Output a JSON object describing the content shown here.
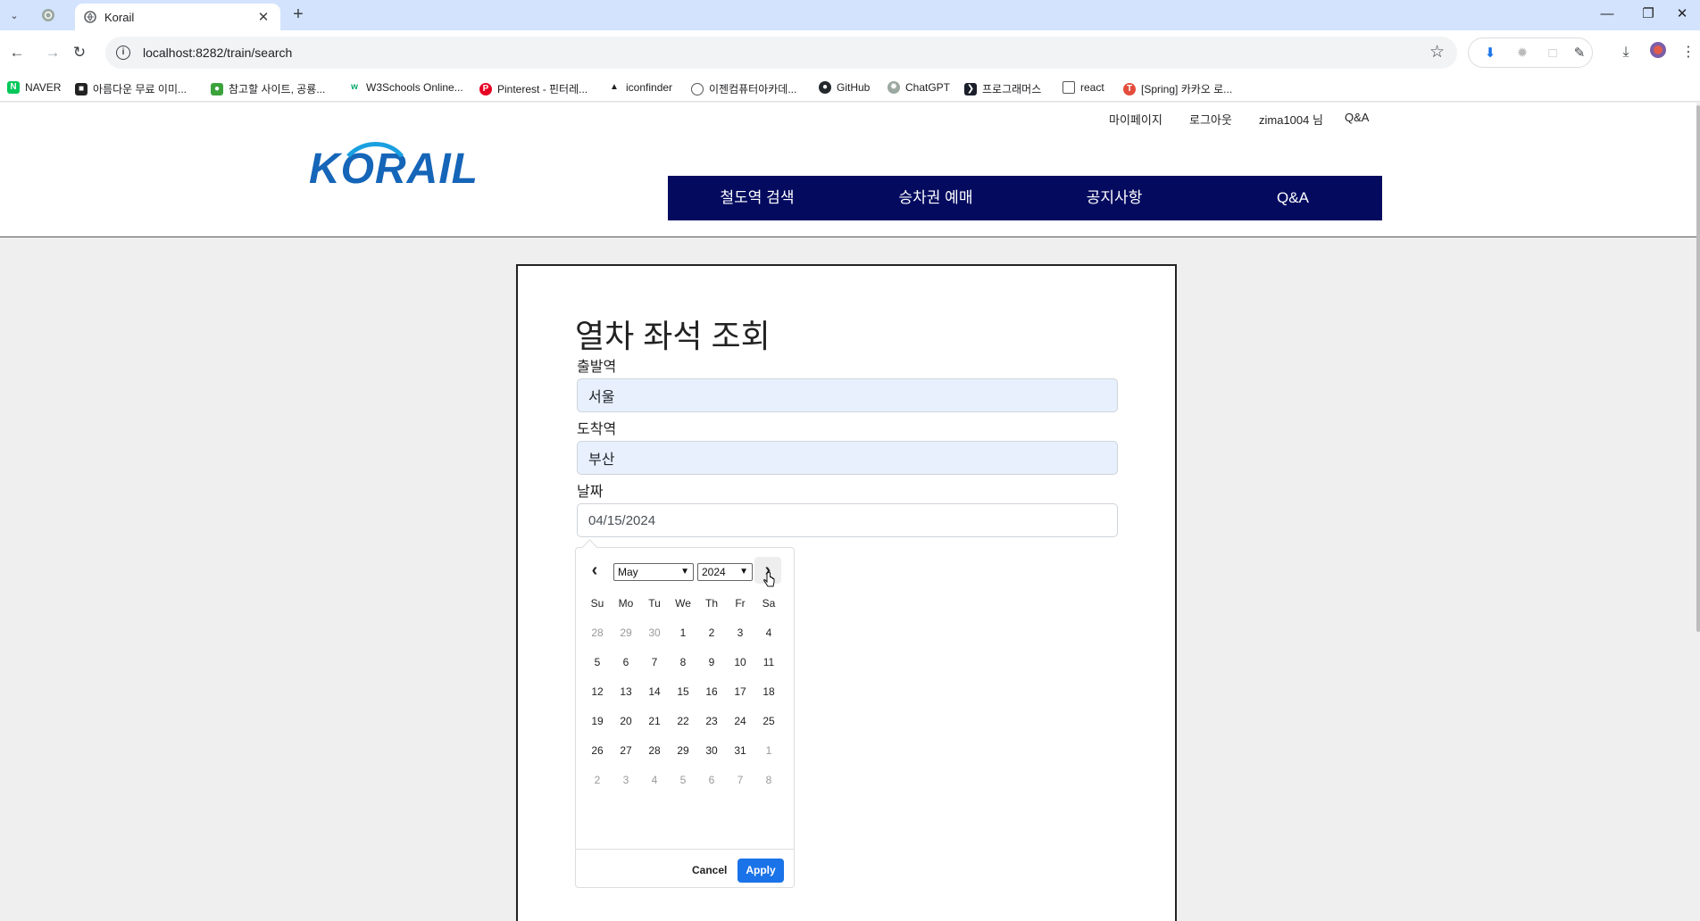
{
  "browser": {
    "tab_title": "Korail",
    "url": "localhost:8282/train/search",
    "bookmarks": [
      "NAVER",
      "아름다운 무료 이미...",
      "참고할 사이트, 공룡...",
      "W3Schools Online...",
      "Pinterest - 핀터레...",
      "iconfinder",
      "이젠컴퓨터아카데...",
      "GitHub",
      "ChatGPT",
      "프로그래머스",
      "react",
      "[Spring] 카카오 로..."
    ]
  },
  "header": {
    "util_links": [
      "마이페이지",
      "로그아웃",
      "zima1004 님",
      "Q&A"
    ],
    "logo_text": "KORAIL",
    "nav": [
      "철도역 검색",
      "승차권 예매",
      "공지사항",
      "Q&A"
    ]
  },
  "form": {
    "title": "열차 좌석 조회",
    "departure_label": "출발역",
    "departure_value": "서울",
    "arrival_label": "도착역",
    "arrival_value": "부산",
    "date_label": "날짜",
    "date_value": "04/15/2024"
  },
  "datepicker": {
    "month": "May",
    "year": "2024",
    "weekdays": [
      "Su",
      "Mo",
      "Tu",
      "We",
      "Th",
      "Fr",
      "Sa"
    ],
    "weeks": [
      [
        "28",
        "29",
        "30",
        "1",
        "2",
        "3",
        "4"
      ],
      [
        "5",
        "6",
        "7",
        "8",
        "9",
        "10",
        "11"
      ],
      [
        "12",
        "13",
        "14",
        "15",
        "16",
        "17",
        "18"
      ],
      [
        "19",
        "20",
        "21",
        "22",
        "23",
        "24",
        "25"
      ],
      [
        "26",
        "27",
        "28",
        "29",
        "30",
        "31",
        "1"
      ],
      [
        "2",
        "3",
        "4",
        "5",
        "6",
        "7",
        "8"
      ]
    ],
    "off_days": [
      [
        0,
        0
      ],
      [
        0,
        1
      ],
      [
        0,
        2
      ],
      [
        4,
        6
      ],
      [
        5,
        0
      ],
      [
        5,
        1
      ],
      [
        5,
        2
      ],
      [
        5,
        3
      ],
      [
        5,
        4
      ],
      [
        5,
        5
      ],
      [
        5,
        6
      ]
    ],
    "cancel_label": "Cancel",
    "apply_label": "Apply"
  },
  "colors": {
    "nav_bg": "#040b5f",
    "apply_bg": "#1a73e8",
    "autofill_bg": "#e8f0fe",
    "logo_blue": "#1565b8"
  }
}
